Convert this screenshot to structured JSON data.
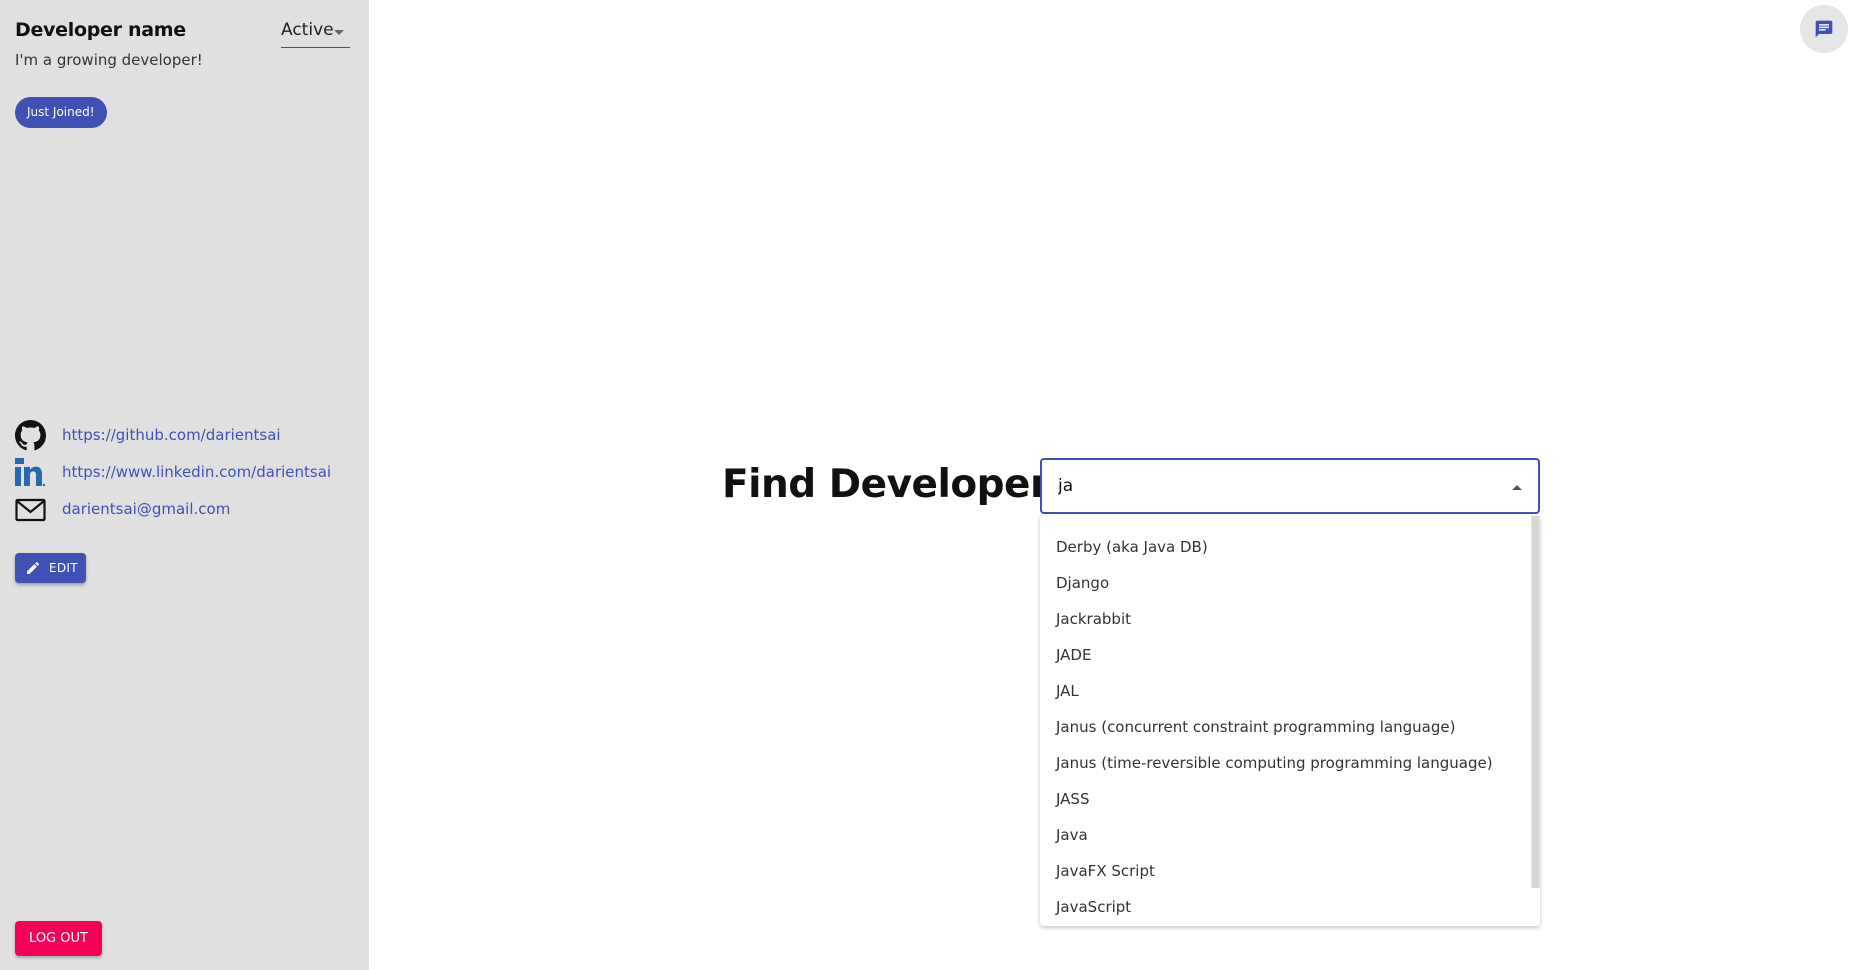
{
  "sidebar": {
    "developer_name": "Developer name",
    "status": "Active",
    "tagline": "I'm a growing developer!",
    "badge": "Just Joined!",
    "links": {
      "github": "https://github.com/darientsai",
      "linkedin": "https://www.linkedin.com/darientsai",
      "email": "darientsai@gmail.com"
    },
    "edit_label": "EDIT",
    "logout_label": "LOG OUT"
  },
  "main": {
    "headline": "Find Developers.",
    "search": {
      "value": "ja"
    },
    "options": [
      "Derby (aka Java DB)",
      "Django",
      "Jackrabbit",
      "JADE",
      "JAL",
      "Janus (concurrent constraint programming language)",
      "Janus (time-reversible computing programming language)",
      "JASS",
      "Java",
      "JavaFX Script",
      "JavaScript"
    ]
  },
  "colors": {
    "primary": "#3f51b5",
    "secondary": "#f50057",
    "sidebar_bg": "#e0e0e0",
    "linkedin_blue": "#2867b2"
  },
  "icons": {
    "github": "github-icon",
    "linkedin": "linkedin-icon",
    "email": "mail-icon",
    "edit": "pencil-icon",
    "chat": "chat-icon"
  }
}
